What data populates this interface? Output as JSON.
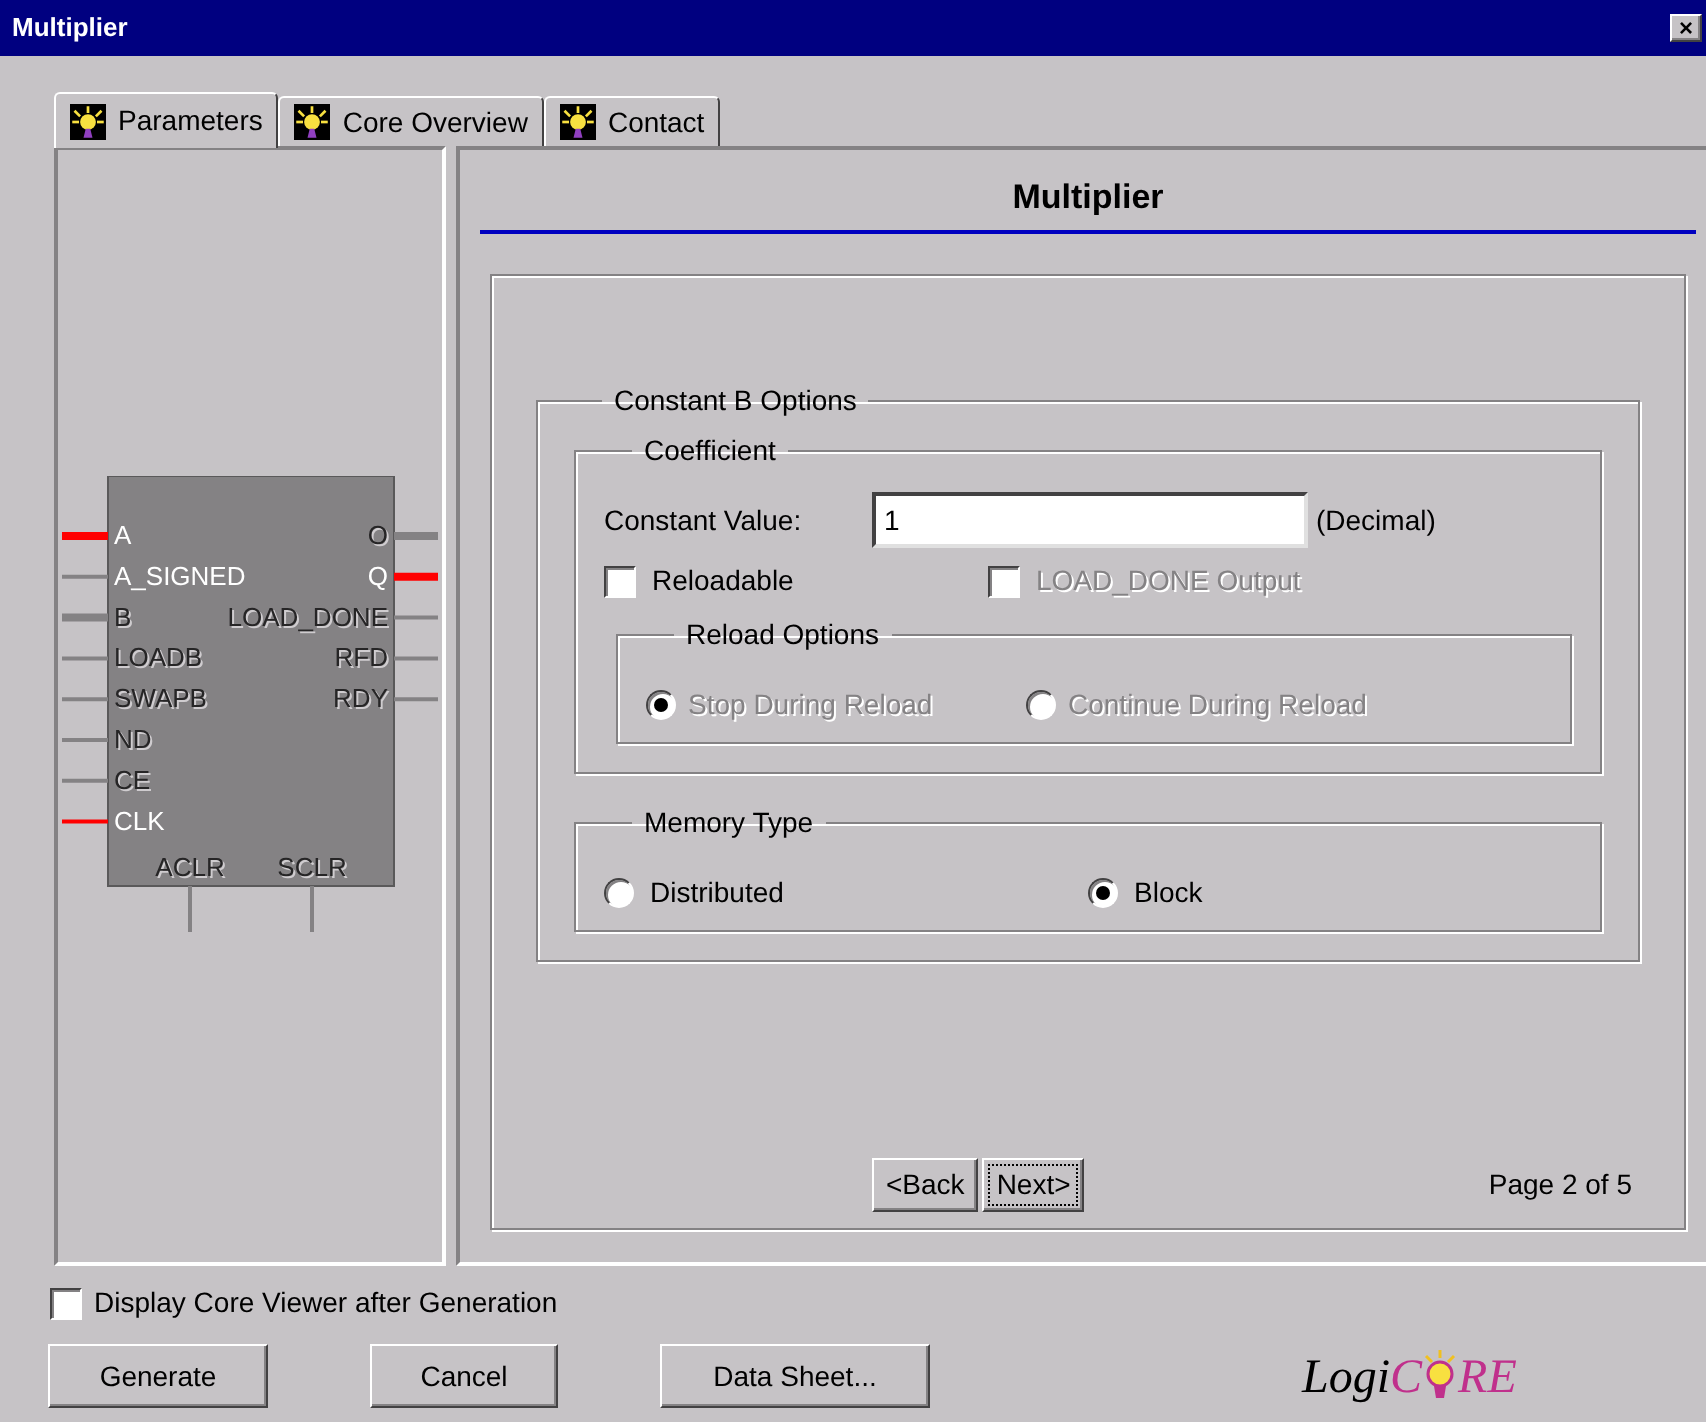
{
  "window": {
    "title": "Multiplier",
    "close": "×"
  },
  "tabs": [
    {
      "label": "Parameters",
      "selected": true
    },
    {
      "label": "Core Overview",
      "selected": false
    },
    {
      "label": "Contact",
      "selected": false
    }
  ],
  "core_symbol": {
    "left_pins": [
      {
        "label": "A",
        "active": true,
        "bus": true,
        "highlighted": true
      },
      {
        "label": "A_SIGNED",
        "active": true,
        "bus": false,
        "highlighted": false
      },
      {
        "label": "B",
        "active": false,
        "bus": true,
        "highlighted": false
      },
      {
        "label": "LOADB",
        "active": false,
        "bus": false,
        "highlighted": false
      },
      {
        "label": "SWAPB",
        "active": false,
        "bus": false,
        "highlighted": false
      },
      {
        "label": "ND",
        "active": false,
        "bus": false,
        "highlighted": false
      },
      {
        "label": "CE",
        "active": false,
        "bus": false,
        "highlighted": false
      },
      {
        "label": "CLK",
        "active": true,
        "bus": false,
        "highlighted": true
      }
    ],
    "right_pins": [
      {
        "label": "O",
        "active": false,
        "bus": true,
        "highlighted": false
      },
      {
        "label": "Q",
        "active": true,
        "bus": true,
        "highlighted": true
      },
      {
        "label": "LOAD_DONE",
        "active": false,
        "bus": false,
        "highlighted": false
      },
      {
        "label": "RFD",
        "active": false,
        "bus": false,
        "highlighted": false
      },
      {
        "label": "RDY",
        "active": false,
        "bus": false,
        "highlighted": false
      }
    ],
    "bottom_pins": [
      {
        "label": "ACLR",
        "active": false
      },
      {
        "label": "SCLR",
        "active": false
      }
    ]
  },
  "heading": "Multiplier",
  "constant_b_options": {
    "title": "Constant B Options",
    "coefficient": {
      "title": "Coefficient",
      "constant_value": {
        "label": "Constant Value:",
        "value": "1",
        "unit": "(Decimal)"
      },
      "checkboxes": [
        {
          "label": "Reloadable",
          "checked": false,
          "disabled": false
        },
        {
          "label": "LOAD_DONE Output",
          "checked": false,
          "disabled": true
        }
      ],
      "reload_options": {
        "title": "Reload Options",
        "disabled": true,
        "radios": [
          {
            "label": "Stop During Reload",
            "selected": true
          },
          {
            "label": "Continue During Reload",
            "selected": false
          }
        ]
      }
    },
    "memory_type": {
      "title": "Memory Type",
      "radios": [
        {
          "label": "Distributed",
          "selected": false
        },
        {
          "label": "Block",
          "selected": true
        }
      ]
    }
  },
  "navigation": {
    "back": {
      "label": "<Back",
      "focused": false
    },
    "next": {
      "label": "Next>",
      "focused": true
    },
    "page": "Page 2 of 5"
  },
  "display_core_viewer": {
    "label": "Display Core Viewer after Generation",
    "checked": false
  },
  "buttons": [
    "Generate",
    "Cancel",
    "Data Sheet..."
  ],
  "logo": {
    "parts": [
      {
        "text": "Logi",
        "color": "#000000"
      },
      {
        "text": "C",
        "color": "#c0308c"
      },
      {
        "text": "RE",
        "color": "#c0308c"
      }
    ]
  }
}
